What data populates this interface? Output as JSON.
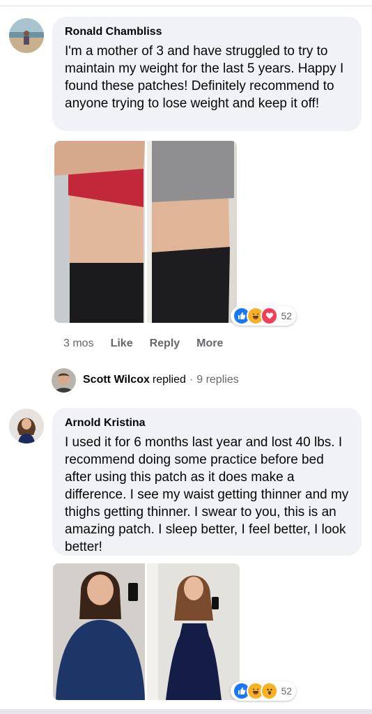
{
  "comments": [
    {
      "author": "Ronald Chambliss",
      "text": "I'm a mother of 3 and have struggled to try to maintain my weight for the last 5 years. Happy I found these patches! Definitely recommend to anyone trying to lose weight and keep it off!",
      "reactions": {
        "icons": [
          "like-icon",
          "haha-icon",
          "love-icon"
        ],
        "count": "52"
      },
      "actions": {
        "time": "3 mos",
        "like": "Like",
        "reply": "Reply",
        "more": "More"
      },
      "reply_summary": {
        "name": "Scott Wilcox",
        "word": "replied",
        "separator": "·",
        "count": "9 replies"
      }
    },
    {
      "author": "Arnold Kristina",
      "text": "I used it for 6 months last year and lost 40 lbs. I recommend doing some practice before bed after using this patch as it does make a difference. I see my waist getting thinner and my thighs getting thinner. I swear to you, this is an amazing patch. I sleep better, I feel better, I look better!",
      "reactions": {
        "icons": [
          "like-icon",
          "haha-icon",
          "wow-icon"
        ],
        "count": "52"
      }
    }
  ],
  "colors": {
    "like": "#1877f2",
    "love": "#f33e58",
    "haha": "#f7b125",
    "bubble": "#f0f2f5",
    "meta": "#65676b"
  }
}
